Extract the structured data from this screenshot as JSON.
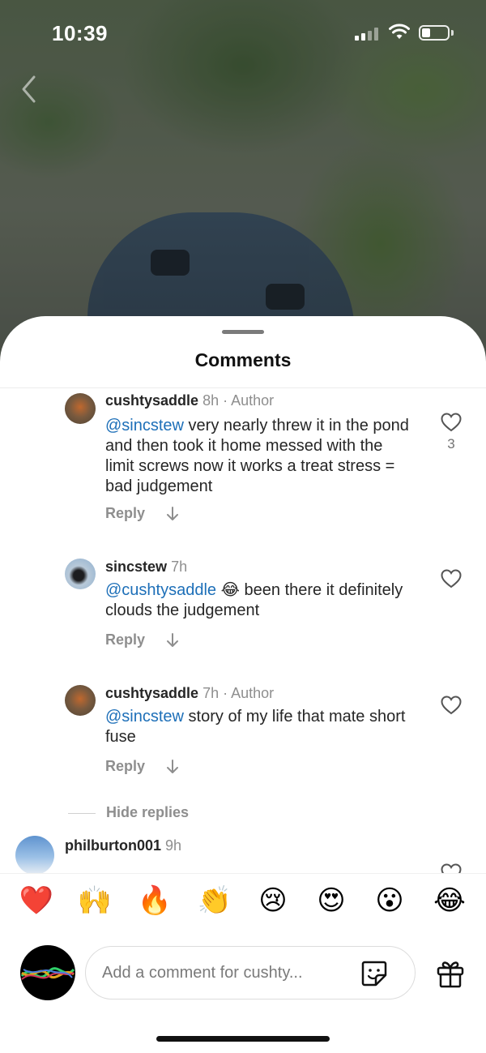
{
  "status_bar": {
    "time": "10:39"
  },
  "sheet": {
    "title": "Comments"
  },
  "comments": [
    {
      "username": "cushtysaddle",
      "time": "8h",
      "author_tag": "· Author",
      "mention": "@sincstew",
      "text": " very nearly threw it in the pond and then took it home messed with the limit screws now it works a treat stress = bad judgement",
      "reply_label": "Reply",
      "likes": "3"
    },
    {
      "username": "sincstew",
      "time": "7h",
      "author_tag": "",
      "mention": "@cushtysaddle",
      "text": " 😂 been there it definitely clouds the judgement",
      "reply_label": "Reply",
      "likes": ""
    },
    {
      "username": "cushtysaddle",
      "time": "7h",
      "author_tag": "· Author",
      "mention": "@sincstew",
      "text": " story of my life that mate short fuse",
      "reply_label": "Reply",
      "likes": ""
    },
    {
      "username": "philburton001",
      "time": "9h"
    }
  ],
  "hide_replies_label": "Hide replies",
  "emoji_bar": [
    "❤️",
    "🙌",
    "🔥",
    "👏",
    "😢",
    "😍",
    "😮",
    "😂"
  ],
  "composer": {
    "placeholder": "Add a comment for cushty..."
  },
  "icons": {
    "back": "chevron-left-icon",
    "like": "heart-icon",
    "translate": "arrow-down-icon",
    "sticker": "sticker-icon",
    "gift": "gift-icon"
  },
  "colors": {
    "mention": "#1d6fb8",
    "secondary_text": "#8e8e8e"
  }
}
